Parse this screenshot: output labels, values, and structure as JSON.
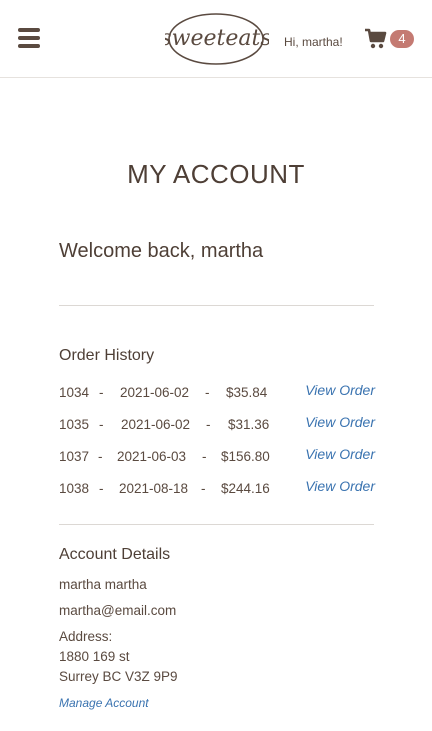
{
  "header": {
    "logo_text": "sweeteats",
    "greeting": "Hi, martha!",
    "cart_count": "4"
  },
  "page_title": "MY ACCOUNT",
  "welcome": "Welcome back, martha",
  "order_history": {
    "heading": "Order History",
    "separator": "-",
    "link_label": "View Order",
    "orders": [
      {
        "id": "1034",
        "date": "2021-06-02",
        "total": "$35.84"
      },
      {
        "id": "1035",
        "date": "2021-06-02",
        "total": "$31.36"
      },
      {
        "id": "1037",
        "date": "2021-06-03",
        "total": "$156.80"
      },
      {
        "id": "1038",
        "date": "2021-08-18",
        "total": "$244.16"
      }
    ]
  },
  "account_details": {
    "heading": "Account Details",
    "name": "martha martha",
    "email": "martha@email.com",
    "address_label": "Address:",
    "address_line1": "1880 169 st",
    "address_line2": "Surrey BC V3Z 9P9",
    "manage_label": "Manage Account"
  },
  "colors": {
    "text": "#5a4a40",
    "link": "#3a73b0",
    "badge": "#c47a72"
  }
}
